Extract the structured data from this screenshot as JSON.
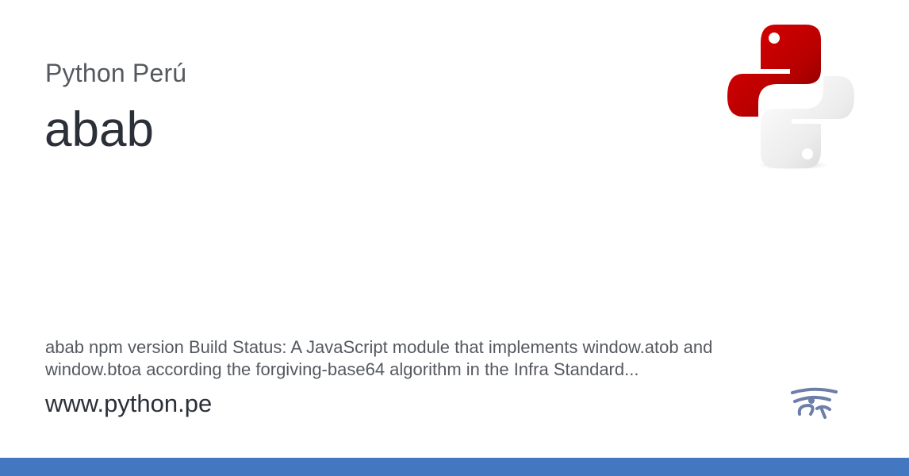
{
  "site": {
    "name": "Python Perú",
    "url": "www.python.pe"
  },
  "page": {
    "title": "abab",
    "description": "abab npm version Build Status: A JavaScript module that implements window.atob and window.btoa according the forgiving-base64 algorithm in the Infra Standard..."
  },
  "icons": {
    "main_logo": "python-logo-icon",
    "footer_logo": "eye-of-horus-icon"
  },
  "colors": {
    "accent_bar": "#4378c0",
    "python_red": "#c80000",
    "python_white": "#f0f0f0",
    "eye_logo": "#6d7ea8"
  }
}
